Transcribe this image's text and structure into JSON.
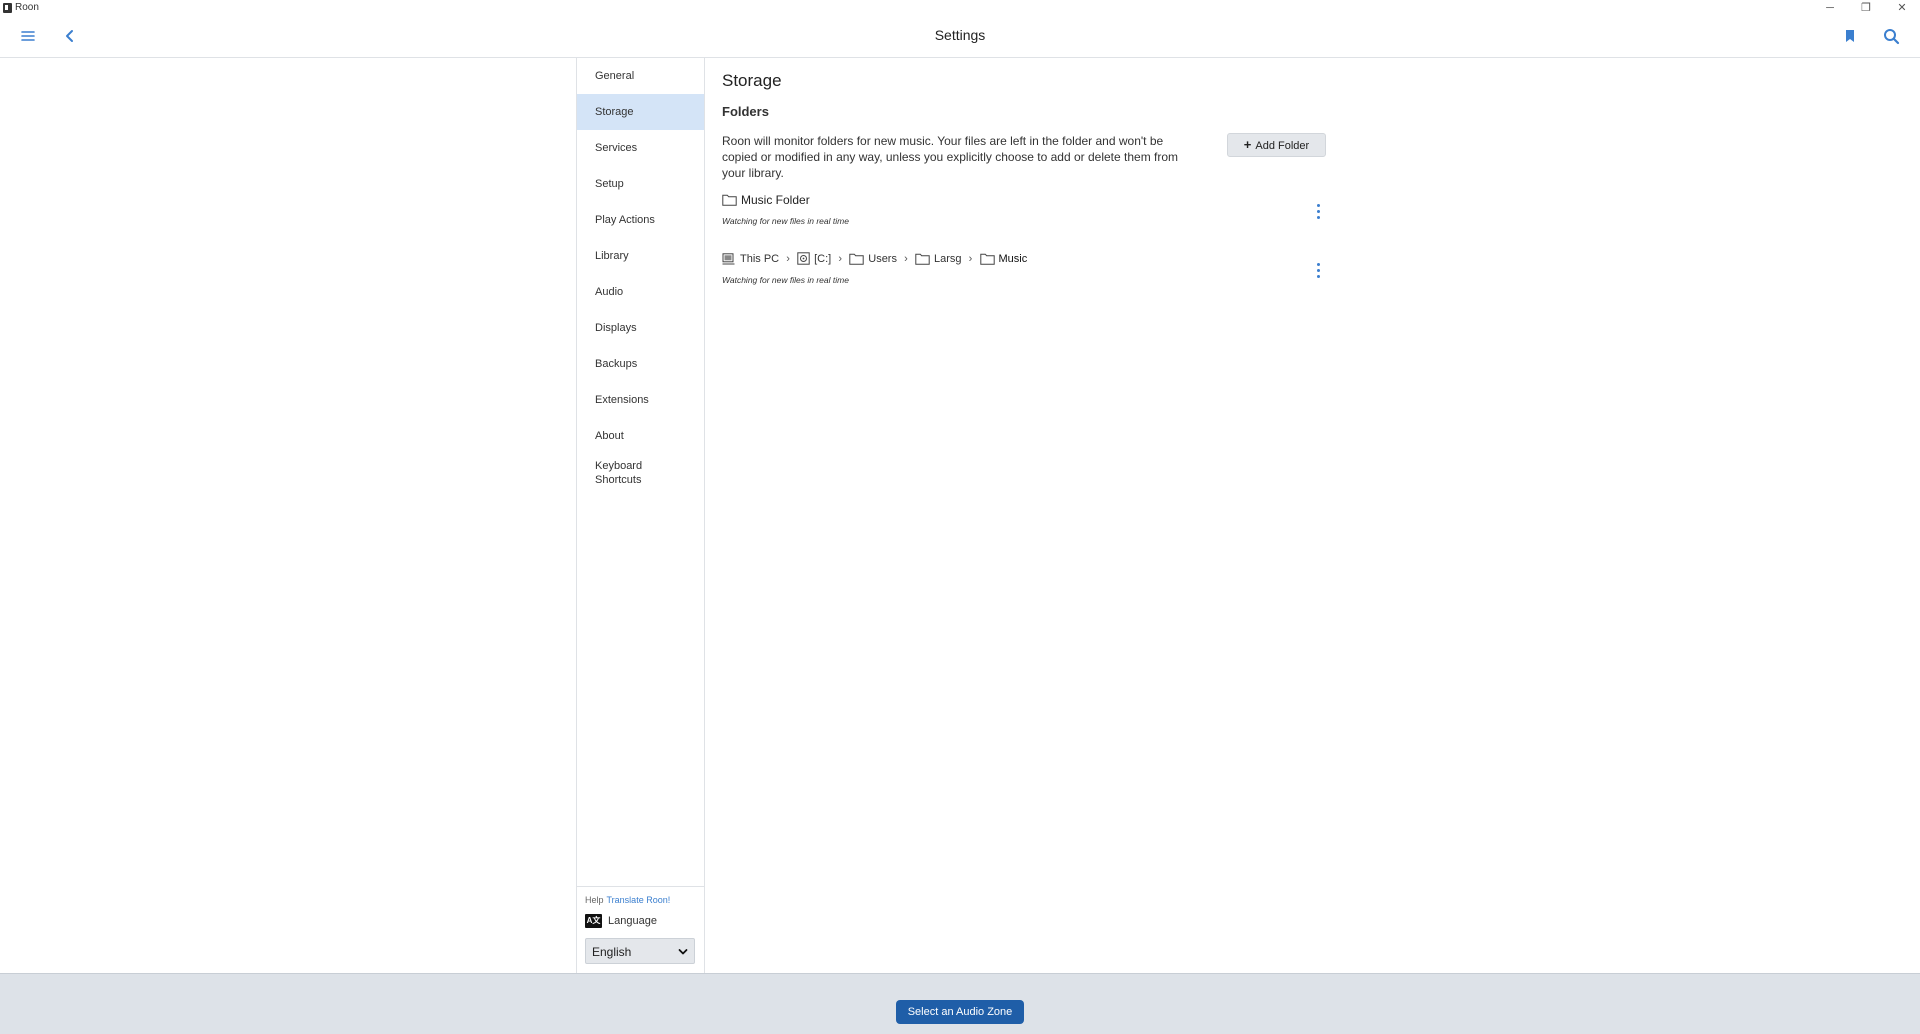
{
  "window": {
    "title": "Roon",
    "minimize_glyph": "─",
    "maximize_glyph": "❐",
    "close_glyph": "✕"
  },
  "header": {
    "title": "Settings",
    "icons": [
      "menu-icon",
      "back-icon",
      "bookmark-icon",
      "search-icon"
    ],
    "accent_color": "#3b7fcf"
  },
  "nav": {
    "items": [
      {
        "label": "General"
      },
      {
        "label": "Storage",
        "active": true
      },
      {
        "label": "Services"
      },
      {
        "label": "Setup"
      },
      {
        "label": "Play Actions"
      },
      {
        "label": "Library"
      },
      {
        "label": "Audio"
      },
      {
        "label": "Displays"
      },
      {
        "label": "Backups"
      },
      {
        "label": "Extensions"
      },
      {
        "label": "About"
      },
      {
        "label": "Keyboard Shortcuts"
      }
    ],
    "footer": {
      "help_label": "Help",
      "help_link": "Translate Roon!",
      "language_label": "Language",
      "language_icon_text": "A文",
      "language_value": "English"
    }
  },
  "main": {
    "heading": "Storage",
    "section": "Folders",
    "description": "Roon will monitor folders for new music. Your files are left in the folder and won't be copied or modified in any way, unless you explicitly choose to add or delete them from your library.",
    "add_folder_label": "Add Folder",
    "folders": [
      {
        "name": "Music Folder",
        "status": "Watching for new files in real time"
      },
      {
        "path": [
          {
            "icon": "computer-icon",
            "label": "This PC"
          },
          {
            "icon": "drive-icon",
            "label": "[C:]"
          },
          {
            "icon": "folder-icon",
            "label": "Users"
          },
          {
            "icon": "folder-icon",
            "label": "Larsg"
          },
          {
            "icon": "folder-icon",
            "label": "Music"
          }
        ],
        "status": "Watching for new files in real time"
      }
    ]
  },
  "bottom": {
    "zone_button": "Select an Audio Zone",
    "zone_button_color": "#1f5ea8"
  }
}
